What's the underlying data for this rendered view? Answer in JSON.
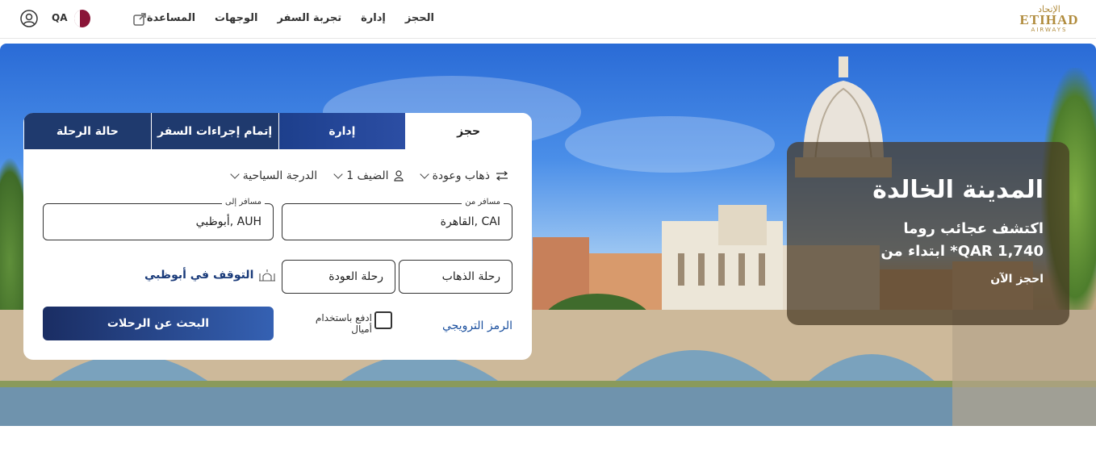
{
  "header": {
    "logo_ar": "الإتحاد",
    "logo_en": "ETIHAD",
    "logo_sub": "AIRWAYS",
    "nav": [
      "الحجز",
      "إدارة",
      "تجربة السفر",
      "الوجهات",
      "المساعدة"
    ],
    "country": "QA",
    "icons": {
      "external": "external-link-icon",
      "flag": "qatar-flag-icon",
      "profile": "user-icon"
    }
  },
  "booking": {
    "tabs": [
      "حجز",
      "إدارة",
      "إتمام إجراءات السفر",
      "حالة الرحلة"
    ],
    "trip_type": "ذهاب وعودة",
    "guests": "1 الضيف",
    "cabin": "الدرجة السياحية",
    "from": {
      "label": "مسافر من",
      "value": "القاهرة, CAI"
    },
    "to": {
      "label": "مسافر إلى",
      "value": "أبوظبي, AUH"
    },
    "depart": "رحلة الذهاب",
    "return": "رحلة العودة",
    "stopover": "التوقف في أبوظبي",
    "promo_code": "الرمز الترويجي",
    "pay_miles": "ادفع باستخدام أميال",
    "search": "البحث عن الرحلات"
  },
  "promo": {
    "title": "المدينة الخالدة",
    "line1": "اكتشف عجائب روما",
    "line2": "ابتداء من *QAR 1,740",
    "cta": "احجز الآن"
  },
  "carousel": {
    "slides": 5,
    "active": 2
  }
}
